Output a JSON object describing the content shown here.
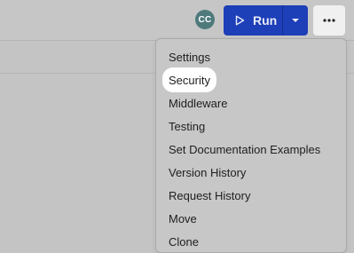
{
  "header": {
    "avatar_initials": "CC",
    "run_label": "Run",
    "icons": [
      "play-icon",
      "chevron-down-icon",
      "more-horizontal-icon"
    ],
    "colors": {
      "run_button": "#1d3fb8",
      "avatar": "#4f7a7c",
      "highlight": "#ffffff"
    }
  },
  "menu": {
    "items": [
      {
        "label": "Settings"
      },
      {
        "label": "Security",
        "highlighted": true
      },
      {
        "label": "Middleware"
      },
      {
        "label": "Testing"
      },
      {
        "label": "Set Documentation Examples"
      },
      {
        "label": "Version History"
      },
      {
        "label": "Request History"
      },
      {
        "label": "Move"
      },
      {
        "label": "Clone"
      }
    ]
  }
}
